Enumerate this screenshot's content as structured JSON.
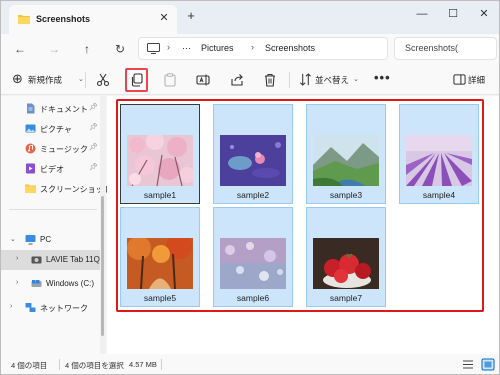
{
  "tab": {
    "title": "Screenshots"
  },
  "window_controls": {
    "minimize": "—",
    "maximize": "☐",
    "close": "✕"
  },
  "address": {
    "more": "···",
    "segments": [
      "Pictures",
      "Screenshots"
    ]
  },
  "search": {
    "placeholder": "Screenshots("
  },
  "toolbar": {
    "new_label": "新規作成",
    "sort_label": "並べ替え",
    "more_label": "•••",
    "details_label": "詳細"
  },
  "sidebar": {
    "quick_access": [
      {
        "label": "ドキュメント",
        "icon": "document-icon"
      },
      {
        "label": "ピクチャ",
        "icon": "pictures-icon"
      },
      {
        "label": "ミュージック",
        "icon": "music-icon"
      },
      {
        "label": "ビデオ",
        "icon": "video-icon"
      },
      {
        "label": "スクリーンショット",
        "icon": "folder-icon"
      }
    ],
    "pc": {
      "label": "PC"
    },
    "drives": [
      {
        "label": "LAVIE Tab 11Q",
        "icon": "device-icon",
        "selected": true
      },
      {
        "label": "Windows (C:)",
        "icon": "drive-icon"
      }
    ],
    "network": {
      "label": "ネットワーク"
    }
  },
  "files": [
    {
      "name": "sample1",
      "focused": true
    },
    {
      "name": "sample2"
    },
    {
      "name": "sample3"
    },
    {
      "name": "sample4"
    },
    {
      "name": "sample5"
    },
    {
      "name": "sample6"
    },
    {
      "name": "sample7"
    }
  ],
  "status": {
    "items": "4 個の項目",
    "selected": "4 個の項目を選択",
    "size": "4.57 MB"
  },
  "colors": {
    "selection_fill": "#cce5fb",
    "selection_border": "#99ccf3",
    "highlight_red": "#e01818",
    "accent": "#0067c0"
  }
}
